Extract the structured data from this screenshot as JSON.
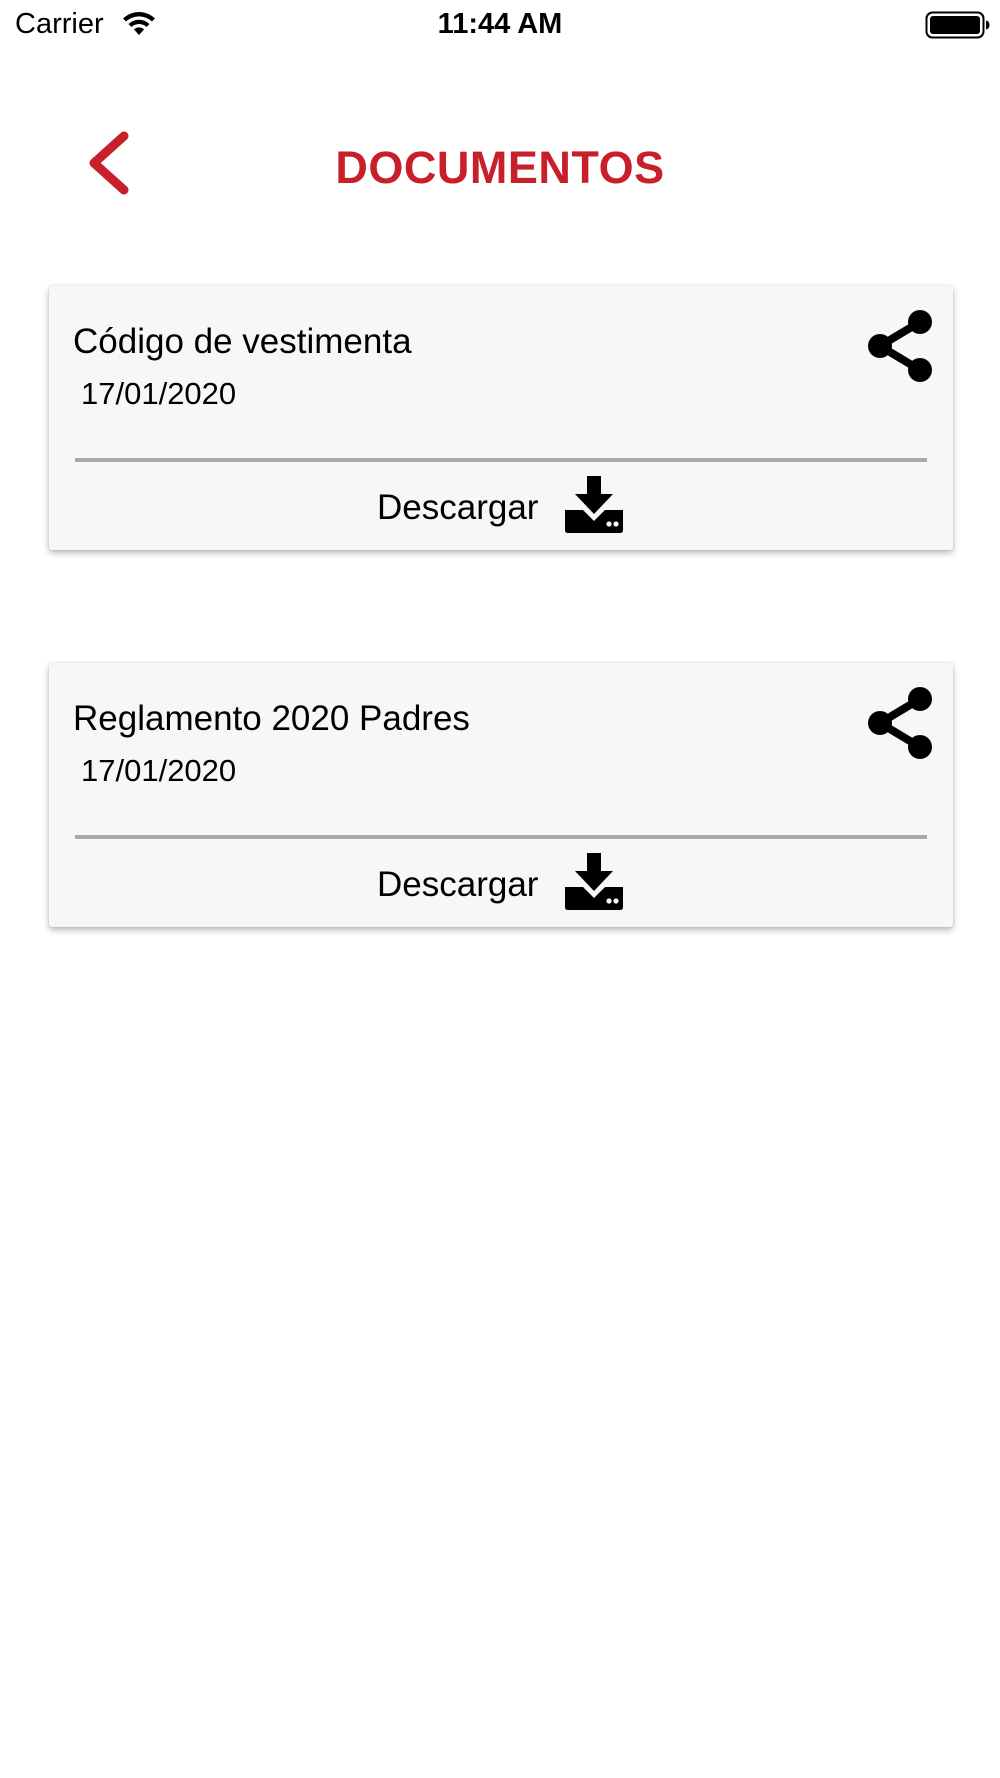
{
  "status_bar": {
    "carrier": "Carrier",
    "time": "11:44 AM",
    "icons": [
      "wifi-icon",
      "battery-icon"
    ]
  },
  "header": {
    "title": "DOCUMENTOS",
    "back_icon": "chevron-left-icon"
  },
  "documents": [
    {
      "title": "Código de vestimenta",
      "date": "17/01/2020",
      "action_label": "Descargar",
      "share_icon": "share-icon",
      "download_icon": "download-icon"
    },
    {
      "title": "Reglamento 2020 Padres",
      "date": "17/01/2020",
      "action_label": "Descargar",
      "share_icon": "share-icon",
      "download_icon": "download-icon"
    }
  ],
  "colors": {
    "accent": "#c8202a",
    "card_background": "#f7f7f7",
    "divider": "#a8a8a8",
    "text": "#000000"
  }
}
